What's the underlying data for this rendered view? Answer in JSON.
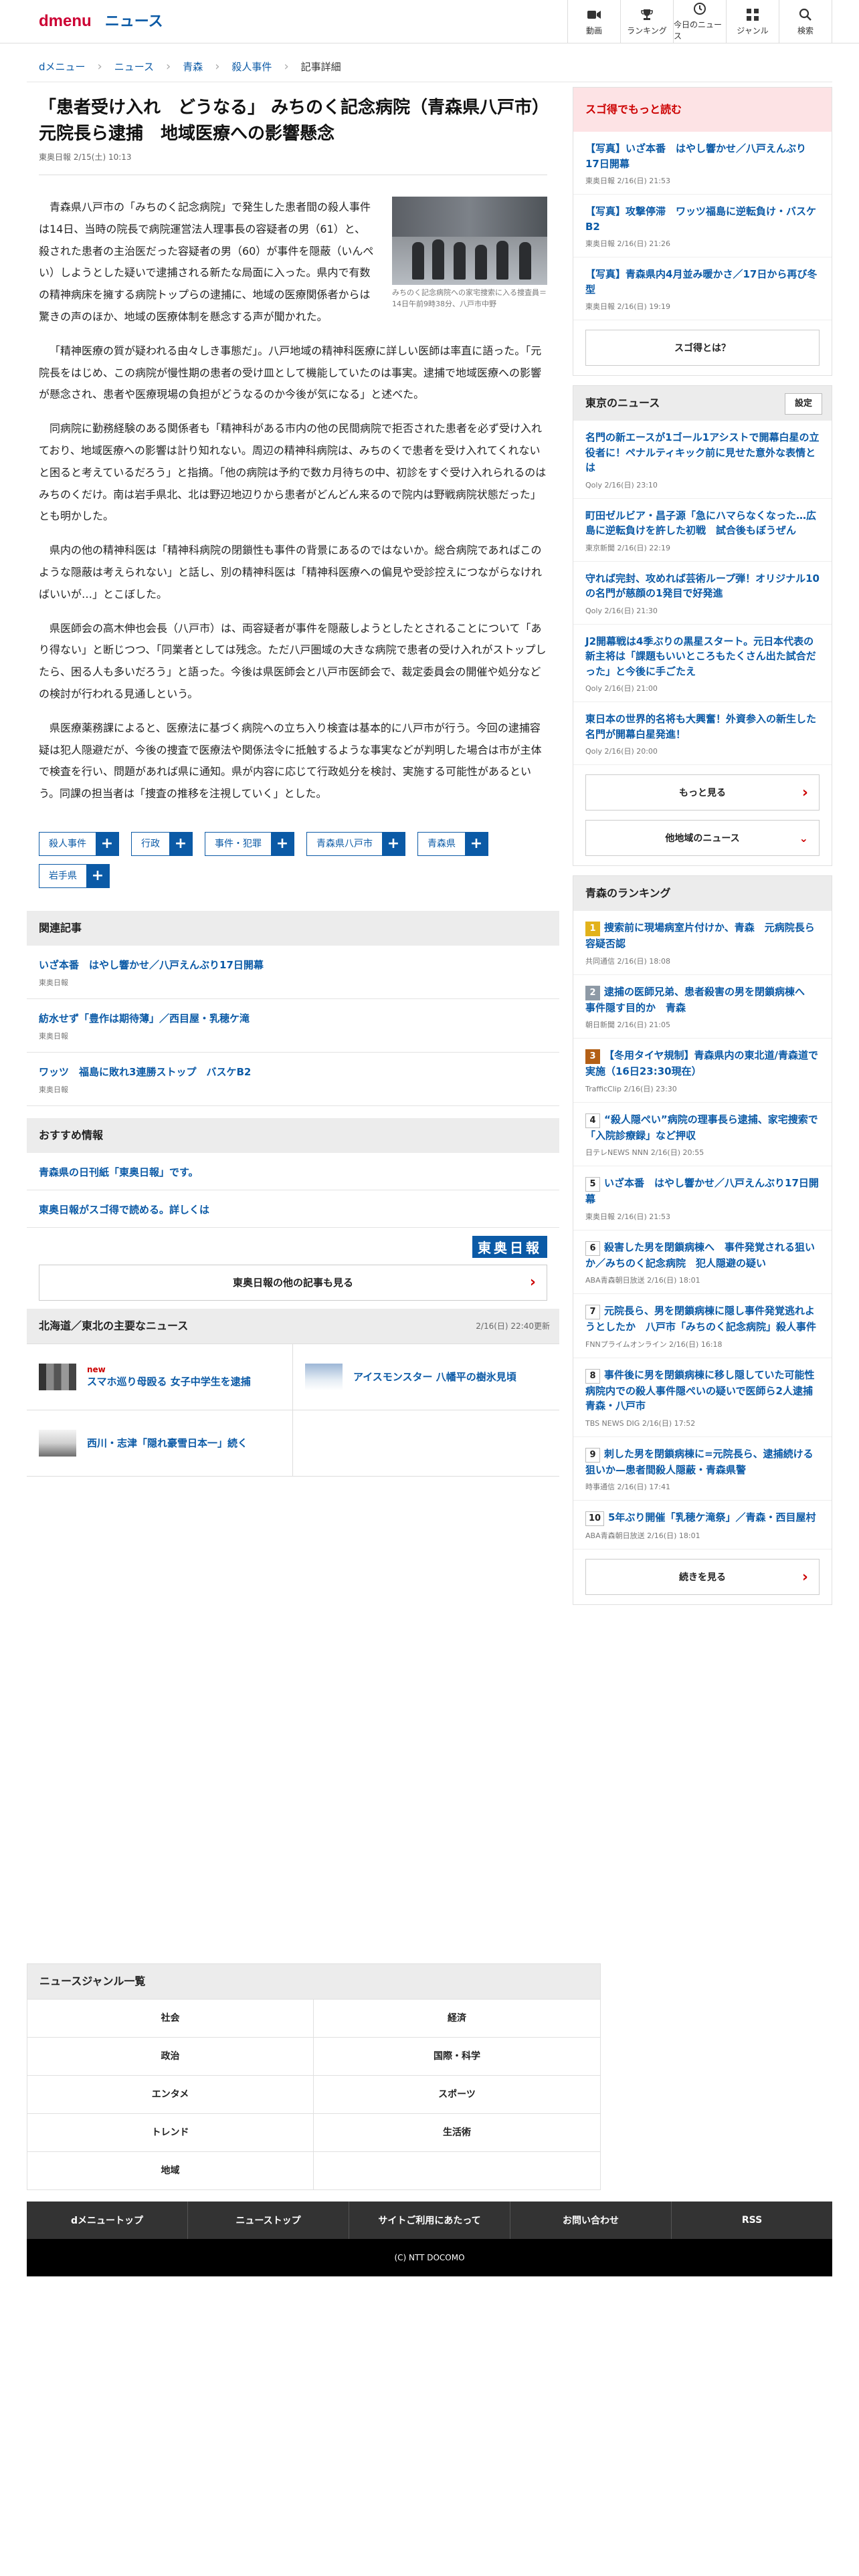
{
  "header": {
    "brand_d": "d",
    "brand_menu": "menu",
    "brand_news": "ニュース",
    "nav": [
      {
        "label": "動画",
        "icon": "video-icon"
      },
      {
        "label": "ランキング",
        "icon": "trophy-icon"
      },
      {
        "label": "今日のニュース",
        "icon": "clock-icon"
      },
      {
        "label": "ジャンル",
        "icon": "grid-icon"
      },
      {
        "label": "検索",
        "icon": "search-icon"
      }
    ]
  },
  "breadcrumb": [
    "dメニュー",
    "ニュース",
    "青森",
    "殺人事件",
    "記事詳細"
  ],
  "article": {
    "title": "「患者受け入れ　どうなる」 みちのく記念病院（青森県八戸市）元院長ら逮捕　地域医療への影響懸念",
    "meta": "東奥日報 2/15(土) 10:13",
    "photo_caption": "みちのく記念病院への家宅捜索に入る捜査員＝14日午前9時38分、八戸市中野",
    "paragraphs": [
      "青森県八戸市の「みちのく記念病院」で発生した患者間の殺人事件は14日、当時の院長で病院運営法人理事長の容疑者の男（61）と、殺された患者の主治医だった容疑者の男（60）が事件を隠蔽（いんぺい）しようとした疑いで逮捕される新たな局面に入った。県内で有数の精神病床を擁する病院トップらの逮捕に、地域の医療関係者からは驚きの声のほか、地域の医療体制を懸念する声が聞かれた。",
      "「精神医療の質が疑われる由々しき事態だ」。八戸地域の精神科医療に詳しい医師は率直に語った。「元院長をはじめ、この病院が慢性期の患者の受け皿として機能していたのは事実。逮捕で地域医療への影響が懸念され、患者や医療現場の負担がどうなるのか今後が気になる」と述べた。",
      "同病院に勤務経験のある関係者も「精神科がある市内の他の民間病院で拒否された患者を必ず受け入れており、地域医療への影響は計り知れない。周辺の精神科病院は、みちのくで患者を受け入れてくれないと困ると考えているだろう」と指摘。「他の病院は予約で数カ月待ちの中、初診をすぐ受け入れられるのはみちのくだけ。南は岩手県北、北は野辺地辺りから患者がどんどん来るので院内は野戦病院状態だった」とも明かした。",
      "県内の他の精神科医は「精神科病院の閉鎖性も事件の背景にあるのではないか。総合病院であればこのような隠蔽は考えられない」と話し、別の精神科医は「精神科医療への偏見や受診控えにつながらなければいいが…」とこぼした。",
      "県医師会の高木伸也会長（八戸市）は、両容疑者が事件を隠蔽しようとしたとされることについて「あり得ない」と断じつつ、「同業者としては残念。ただ八戸圏域の大きな病院で患者の受け入れがストップしたら、困る人も多いだろう」と語った。今後は県医師会と八戸市医師会で、裁定委員会の開催や処分などの検討が行われる見通しという。",
      "県医療薬務課によると、医療法に基づく病院への立ち入り検査は基本的に八戸市が行う。今回の逮捕容疑は犯人隠避だが、今後の捜査で医療法や関係法令に抵触するような事実などが判明した場合は市が主体で検査を行い、問題があれば県に通知。県が内容に応じて行政処分を検討、実施する可能性があるという。同課の担当者は「捜査の推移を注視していく」とした。"
    ],
    "tags": [
      "殺人事件",
      "行政",
      "事件・犯罪",
      "青森県八戸市",
      "青森県",
      "岩手県"
    ]
  },
  "related": {
    "heading": "関連記事",
    "items": [
      {
        "title": "いざ本番　はやし響かせ／八戸えんぶり17日開幕",
        "source": "東奥日報"
      },
      {
        "title": "紡水せず「豊作は期待薄」／西目屋・乳穂ケ滝",
        "source": "東奥日報"
      },
      {
        "title": "ワッツ　福島に敗れ3連勝ストップ　バスケB2",
        "source": "東奥日報"
      }
    ]
  },
  "recommended": {
    "heading": "おすすめ情報",
    "items": [
      "青森県の日刊紙「東奥日報」です。",
      "東奥日報がスゴ得で読める。詳しくは"
    ],
    "logo": "東奥日報",
    "more_button": "東奥日報の他の記事も見る"
  },
  "regional": {
    "heading": "北海道／東北の主要なニュース",
    "updated": "2/16(日) 22:40更新",
    "items": [
      {
        "title": "スマホ巡り母殴る 女子中学生を逮捕",
        "new": "new"
      },
      {
        "title": "アイスモンスター 八幡平の樹氷見頃",
        "new": ""
      },
      {
        "title": "西川・志津「隠れ豪雪日本一」続く",
        "new": ""
      }
    ]
  },
  "sidebar": {
    "sugotoku": {
      "heading": "スゴ得でもっと読む",
      "items": [
        {
          "title": "【写真】いざ本番　はやし響かせ／八戸えんぶり17日開幕",
          "source": "東奥日報 2/16(日) 21:53"
        },
        {
          "title": "【写真】攻撃停滞　ワッツ福島に逆転負け・バスケB2",
          "source": "東奥日報 2/16(日) 21:26"
        },
        {
          "title": "【写真】青森県内4月並み暖かさ／17日から再び冬型",
          "source": "東奥日報 2/16(日) 19:19"
        }
      ],
      "button": "スゴ得とは？"
    },
    "tokyo": {
      "heading": "東京のニュース",
      "settings": "設定",
      "items": [
        {
          "title": "名門の新エースが1ゴール1アシストで開幕白星の立役者に！ペナルティキック前に見せた意外な表情とは",
          "source": "Qoly 2/16(日) 23:10"
        },
        {
          "title": "町田ゼルビア・昌子源「急にハマらなくなった…広島に逆転負けを許した初戦　試合後もぼうぜん",
          "source": "東京新聞 2/16(日) 22:19"
        },
        {
          "title": "守れば完封、攻めれば芸術ループ弾！オリジナル10の名門が慈顔の1発目で好発進",
          "source": "Qoly 2/16(日) 21:30"
        },
        {
          "title": "J2開幕戦は4季ぶりの黒星スタート。元日本代表の新主将は「課題もいいところもたくさん出た試合だった」と今後に手ごたえ",
          "source": "Qoly 2/16(日) 21:00"
        },
        {
          "title": "東日本の世界的名将も大興奮！外資参入の新生した名門が開幕白星発進！",
          "source": "Qoly 2/16(日) 20:00"
        }
      ],
      "more": "もっと見る",
      "other": "他地域のニュース"
    },
    "ranking": {
      "heading": "青森のランキング",
      "items": [
        {
          "rank": "1",
          "title": "捜索前に現場病室片付けか、青森　元病院長ら容疑否認",
          "source": "共同通信 2/16(日) 18:08"
        },
        {
          "rank": "2",
          "title": "逮捕の医師兄弟、患者殺害の男を閉鎖病棟へ　事件隠す目的か　青森",
          "source": "朝日新聞 2/16(日) 21:05"
        },
        {
          "rank": "3",
          "title": "【冬用タイヤ規制】青森県内の東北道/青森道で実施（16日23:30現在）",
          "source": "TrafficClip 2/16(日) 23:30"
        },
        {
          "rank": "4",
          "title": "“殺人隠ぺい”病院の理事長ら逮捕、家宅捜索で「入院診療録」など押収",
          "source": "日テレNEWS NNN 2/16(日) 20:55"
        },
        {
          "rank": "5",
          "title": "いざ本番　はやし響かせ／八戸えんぶり17日開幕",
          "source": "東奥日報 2/16(日) 21:53"
        },
        {
          "rank": "6",
          "title": "殺害した男を閉鎖病棟へ　事件発覚される狙いか／みちのく記念病院　犯人隠避の疑い",
          "source": "ABA青森朝日放送 2/16(日) 18:01"
        },
        {
          "rank": "7",
          "title": "元院長ら、男を閉鎖病棟に隠し事件発覚逃れようとしたか　八戸市「みちのく記念病院」殺人事件",
          "source": "FNNプライムオンライン 2/16(日) 16:18"
        },
        {
          "rank": "8",
          "title": "事件後に男を閉鎖病棟に移し隠していた可能性　病院内での殺人事件隠ぺいの疑いで医師ら2人逮捕　青森・八戸市",
          "source": "TBS NEWS DIG 2/16(日) 17:52"
        },
        {
          "rank": "9",
          "title": "刺した男を閉鎖病棟に=元院長ら、逮捕続ける狙いか—患者間殺人隠蔽・青森県警",
          "source": "時事通信 2/16(日) 17:41"
        },
        {
          "rank": "10",
          "title": "5年ぶり開催「乳穂ケ滝祭」／青森・西目屋村",
          "source": "ABA青森朝日放送 2/16(日) 18:01"
        }
      ],
      "more": "続きを見る"
    }
  },
  "genre": {
    "heading": "ニュースジャンル一覧",
    "items": [
      "社会",
      "経済",
      "政治",
      "国際・科学",
      "エンタメ",
      "スポーツ",
      "トレンド",
      "生活術",
      "地域"
    ]
  },
  "footer": {
    "nav": [
      "dメニュートップ",
      "ニューストップ",
      "サイトご利用にあたって",
      "お問い合わせ",
      "RSS"
    ],
    "copyright": "(C) NTT DOCOMO"
  },
  "colors": {
    "brand": "#cc0033",
    "link": "#0b5aa6",
    "accent_red": "#cc0000"
  }
}
